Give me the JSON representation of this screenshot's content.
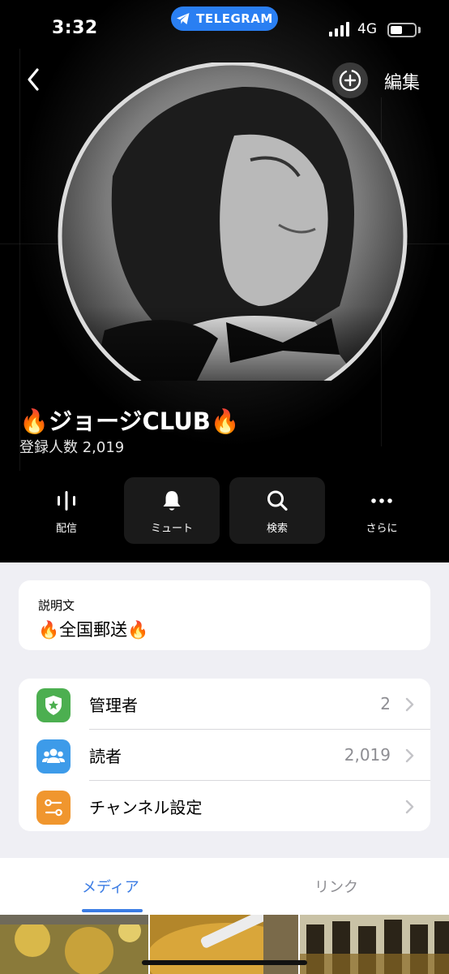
{
  "status_bar": {
    "time": "3:32",
    "app_badge": "TELEGRAM",
    "network": "4G"
  },
  "header": {
    "back_icon": "chevron-left-icon",
    "add_photo_icon": "add-photo-icon",
    "edit_label": "編集"
  },
  "channel": {
    "name": "ジョージCLUB",
    "name_emoji": "🔥",
    "subscribers": "登録人数 2,019"
  },
  "actions": [
    {
      "label": "配信",
      "icon": "broadcast-icon"
    },
    {
      "label": "ミュート",
      "icon": "bell-icon"
    },
    {
      "label": "検索",
      "icon": "search-icon"
    },
    {
      "label": "さらに",
      "icon": "more-icon"
    }
  ],
  "description": {
    "heading": "説明文",
    "text": "全国郵送",
    "emoji": "🔥"
  },
  "settings": [
    {
      "label": "管理者",
      "value": "2",
      "icon": "admin-badge-icon",
      "color": "#4caf50"
    },
    {
      "label": "読者",
      "value": "2,019",
      "icon": "subscribers-icon",
      "color": "#3d9be9"
    },
    {
      "label": "チャンネル設定",
      "value": "",
      "icon": "settings-toggle-icon",
      "color": "#f0962e"
    }
  ],
  "media_tabs": [
    {
      "label": "メディア",
      "active": true
    },
    {
      "label": "リンク",
      "active": false
    }
  ],
  "colors": {
    "accent": "#3b7ce4",
    "telegram_badge": "#2a7ff2"
  }
}
